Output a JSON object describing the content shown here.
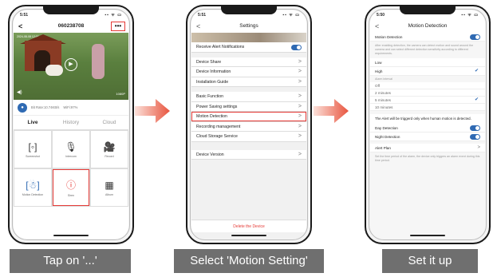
{
  "status_time": "5:51",
  "status_time_3": "5:50",
  "status_icons": "▪▪ ᯤ ▭",
  "screen1": {
    "device_id": "060238708",
    "back_glyph": "<",
    "more_label": "•••",
    "overlay_timestamp": "2024-08-08 12:00:09",
    "overlay_resolution": "1080P",
    "bitrate": "Bit Rate:10.74KB/s",
    "wifi": "WiFi:97%",
    "tabs": [
      "Live",
      "History",
      "Cloud"
    ],
    "tiles": [
      {
        "label": "Screenshot",
        "icon": "screenshot-icon"
      },
      {
        "label": "Intercom",
        "icon": "microphone-icon"
      },
      {
        "label": "Record",
        "icon": "camera-record-icon"
      },
      {
        "label": "Motion Detection",
        "icon": "motion-detection-icon"
      },
      {
        "label": "Siren",
        "icon": "siren-icon"
      },
      {
        "label": "Album",
        "icon": "album-icon"
      }
    ]
  },
  "screen2": {
    "title": "Settings",
    "rows": {
      "receive_alert": "Receive Alert Notifications",
      "device_share": "Device Share",
      "device_info": "Device Information",
      "install_guide": "Installation Guide",
      "basic_function": "Basic Function",
      "power_saving": "Power Saving settings",
      "motion_detection": "Motion Detection",
      "recording_mgmt": "Recording management",
      "cloud_storage": "Cloud Storage Service",
      "device_version": "Device Version"
    },
    "delete_label": "Delete the Device"
  },
  "screen3": {
    "title": "Motion Detection",
    "motion_label": "Motion Detection",
    "description": "After enabling detection, the camera can detect motion and sound around the camera and can select different detection sensitivity according to different requirements.",
    "sensitivity": [
      "Low",
      "High"
    ],
    "alarm_interval_label": "Alarm interval",
    "intervals": [
      "Off",
      "2 minutes",
      "5 minutes",
      "10 minutes"
    ],
    "alert_note": "The Alert will be triggerd only when human motion is detected.",
    "day_detection": "Day Detection",
    "night_detection": "Night Detection",
    "alert_plan": "Alert Plan",
    "plan_note": "Set the time period of the alarm, the device only triggers an alarm event during this time period."
  },
  "captions": [
    "Tap on '...'",
    "Select 'Motion Setting'",
    "Set it up"
  ],
  "colors": {
    "accent": "#2f6ab3",
    "highlight": "#e53935",
    "arrow": "#e8553f",
    "caption_bg": "#6f6f6f"
  }
}
